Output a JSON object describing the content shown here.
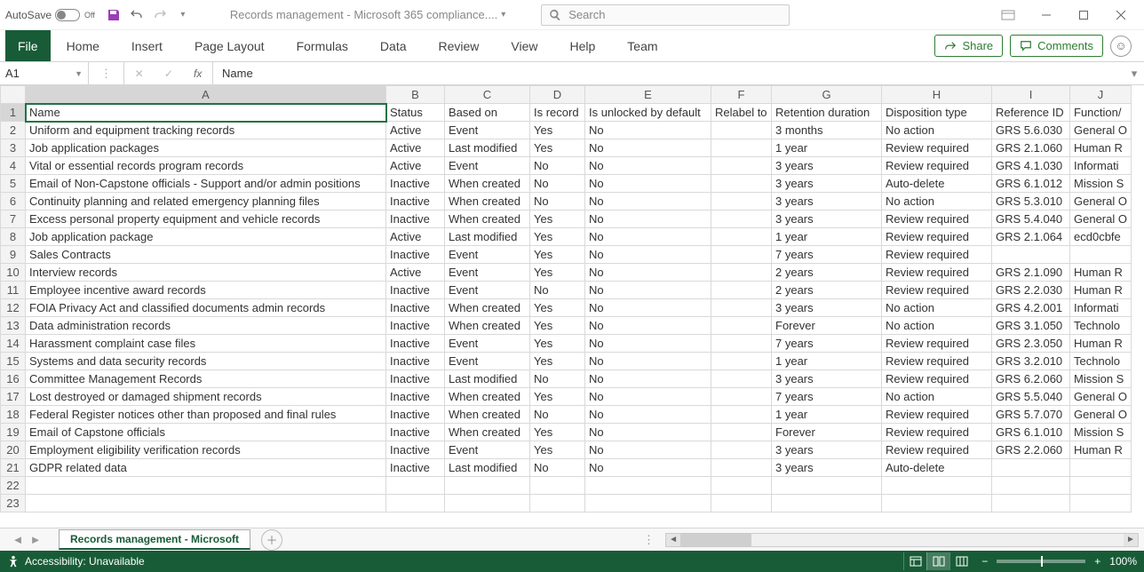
{
  "titlebar": {
    "autosave_label": "AutoSave",
    "autosave_state": "Off",
    "document_title": "Records management - Microsoft 365 compliance....",
    "search_placeholder": "Search"
  },
  "ribbon": {
    "file": "File",
    "tabs": [
      "Home",
      "Insert",
      "Page Layout",
      "Formulas",
      "Data",
      "Review",
      "View",
      "Help",
      "Team"
    ],
    "share": "Share",
    "comments": "Comments"
  },
  "formulabar": {
    "namebox": "A1",
    "formula": "Name"
  },
  "columns": [
    "A",
    "B",
    "C",
    "D",
    "E",
    "F",
    "G",
    "H",
    "I",
    "J"
  ],
  "headers": [
    "Name",
    "Status",
    "Based on",
    "Is record",
    "Is unlocked by default",
    "Relabel to",
    "Retention duration",
    "Disposition type",
    "Reference ID",
    "Function/"
  ],
  "rows": [
    [
      "Uniform and equipment tracking records",
      "Active",
      "Event",
      "Yes",
      "No",
      "",
      "3 months",
      "No action",
      "GRS 5.6.030",
      "General O"
    ],
    [
      "Job application packages",
      "Active",
      "Last modified",
      "Yes",
      "No",
      "",
      "1 year",
      "Review required",
      "GRS 2.1.060",
      "Human R"
    ],
    [
      "Vital or essential records program records",
      "Active",
      "Event",
      "No",
      "No",
      "",
      "3 years",
      "Review required",
      "GRS 4.1.030",
      "Informati"
    ],
    [
      "Email of Non-Capstone officials - Support and/or admin positions",
      "Inactive",
      "When created",
      "No",
      "No",
      "",
      "3 years",
      "Auto-delete",
      "GRS 6.1.012",
      "Mission S"
    ],
    [
      "Continuity planning and related emergency planning files",
      "Inactive",
      "When created",
      "No",
      "No",
      "",
      "3 years",
      "No action",
      "GRS 5.3.010",
      "General O"
    ],
    [
      "Excess personal property equipment and vehicle records",
      "Inactive",
      "When created",
      "Yes",
      "No",
      "",
      "3 years",
      "Review required",
      "GRS 5.4.040",
      "General O"
    ],
    [
      "Job application package",
      "Active",
      "Last modified",
      "Yes",
      "No",
      "",
      "1 year",
      "Review required",
      "GRS 2.1.064",
      "ecd0cbfe"
    ],
    [
      "Sales Contracts",
      "Inactive",
      "Event",
      "Yes",
      "No",
      "",
      "7 years",
      "Review required",
      "",
      ""
    ],
    [
      "Interview records",
      "Active",
      "Event",
      "Yes",
      "No",
      "",
      "2 years",
      "Review required",
      "GRS 2.1.090",
      "Human R"
    ],
    [
      "Employee incentive award records",
      "Inactive",
      "Event",
      "No",
      "No",
      "",
      "2 years",
      "Review required",
      "GRS 2.2.030",
      "Human R"
    ],
    [
      "FOIA Privacy Act and classified documents admin records",
      "Inactive",
      "When created",
      "Yes",
      "No",
      "",
      "3 years",
      "No action",
      "GRS 4.2.001",
      "Informati"
    ],
    [
      "Data administration records",
      "Inactive",
      "When created",
      "Yes",
      "No",
      "",
      "Forever",
      "No action",
      "GRS 3.1.050",
      "Technolo"
    ],
    [
      "Harassment complaint case files",
      "Inactive",
      "Event",
      "Yes",
      "No",
      "",
      "7 years",
      "Review required",
      "GRS 2.3.050",
      "Human R"
    ],
    [
      "Systems and data security records",
      "Inactive",
      "Event",
      "Yes",
      "No",
      "",
      "1 year",
      "Review required",
      "GRS 3.2.010",
      "Technolo"
    ],
    [
      "Committee Management Records",
      "Inactive",
      "Last modified",
      "No",
      "No",
      "",
      "3 years",
      "Review required",
      "GRS 6.2.060",
      "Mission S"
    ],
    [
      "Lost destroyed or damaged shipment records",
      "Inactive",
      "When created",
      "Yes",
      "No",
      "",
      "7 years",
      "No action",
      "GRS 5.5.040",
      "General O"
    ],
    [
      "Federal Register notices other than proposed and final rules",
      "Inactive",
      "When created",
      "No",
      "No",
      "",
      "1 year",
      "Review required",
      "GRS 5.7.070",
      "General O"
    ],
    [
      "Email of Capstone officials",
      "Inactive",
      "When created",
      "Yes",
      "No",
      "",
      "Forever",
      "Review required",
      "GRS 6.1.010",
      "Mission S"
    ],
    [
      "Employment eligibility verification records",
      "Inactive",
      "Event",
      "Yes",
      "No",
      "",
      "3 years",
      "Review required",
      "GRS 2.2.060",
      "Human R"
    ],
    [
      "GDPR related data",
      "Inactive",
      "Last modified",
      "No",
      "No",
      "",
      "3 years",
      "Auto-delete",
      "",
      ""
    ]
  ],
  "empty_rows": 2,
  "sheettab": "Records management - Microsoft",
  "statusbar": {
    "accessibility": "Accessibility: Unavailable",
    "zoom": "100%"
  }
}
